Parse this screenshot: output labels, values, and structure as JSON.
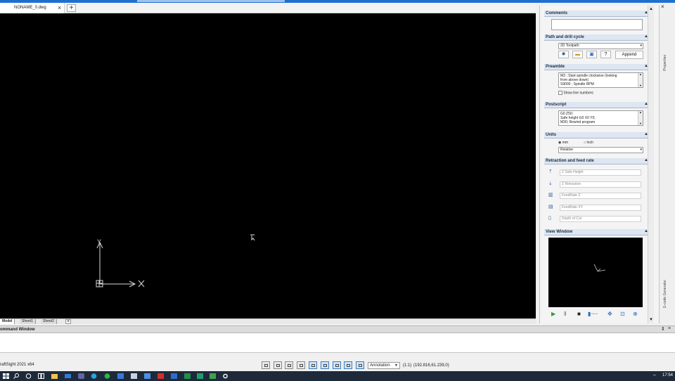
{
  "document_tab": {
    "name": "NONAME_0.dwg",
    "close": "×",
    "new": "+"
  },
  "sheet_tabs": [
    "Model",
    "Sheet1",
    "Sheet2"
  ],
  "sheet_add": "+",
  "ucs": {
    "y_label": "Y",
    "x_label": "X"
  },
  "command_window": {
    "title": "ommand Window",
    "pin": "⇕",
    "close": "×"
  },
  "status": {
    "app_name": "raftSight 2021 x64",
    "annotation": "Annotation",
    "scale": "(1:1)",
    "coordinates": "(192.816,61.239,0)"
  },
  "panel": {
    "comments": {
      "title": "Comments",
      "value": ""
    },
    "path": {
      "title": "Path and drill cycle",
      "selected": "2D Toolpath",
      "help_label": "?",
      "append_label": "Append"
    },
    "preamble": {
      "title": "Preamble",
      "lines": [
        "M3     ; Start spindle clockwise (looking",
        "from above down)",
        "S9000  ; Spindle RPM"
      ],
      "show_line_numbers": "Show line numbers"
    },
    "postscript": {
      "title": "Postscript",
      "lines": [
        "G0 Z50;",
        "Safe height G0 X0 Y0;",
        "M30; Rewind program"
      ]
    },
    "units": {
      "title": "Units",
      "mm": "mm",
      "inch": "Inch",
      "mode": "Relative"
    },
    "retraction": {
      "title": "Retraction and feed rate",
      "fields": [
        {
          "placeholder": "Z Safe Height"
        },
        {
          "placeholder": "Z Retraction"
        },
        {
          "placeholder": "FeedRate Z"
        },
        {
          "placeholder": "FeedRate XY"
        },
        {
          "placeholder": "Depth of Cut"
        }
      ]
    },
    "view_window": {
      "title": "View Window"
    },
    "vertical_tab": "G-code Generator",
    "collapse": "▲"
  },
  "right_strip": {
    "close": "×",
    "tabs": [
      "Properties",
      "G-code Generator"
    ]
  },
  "taskbar": {
    "clock": "17:54"
  }
}
